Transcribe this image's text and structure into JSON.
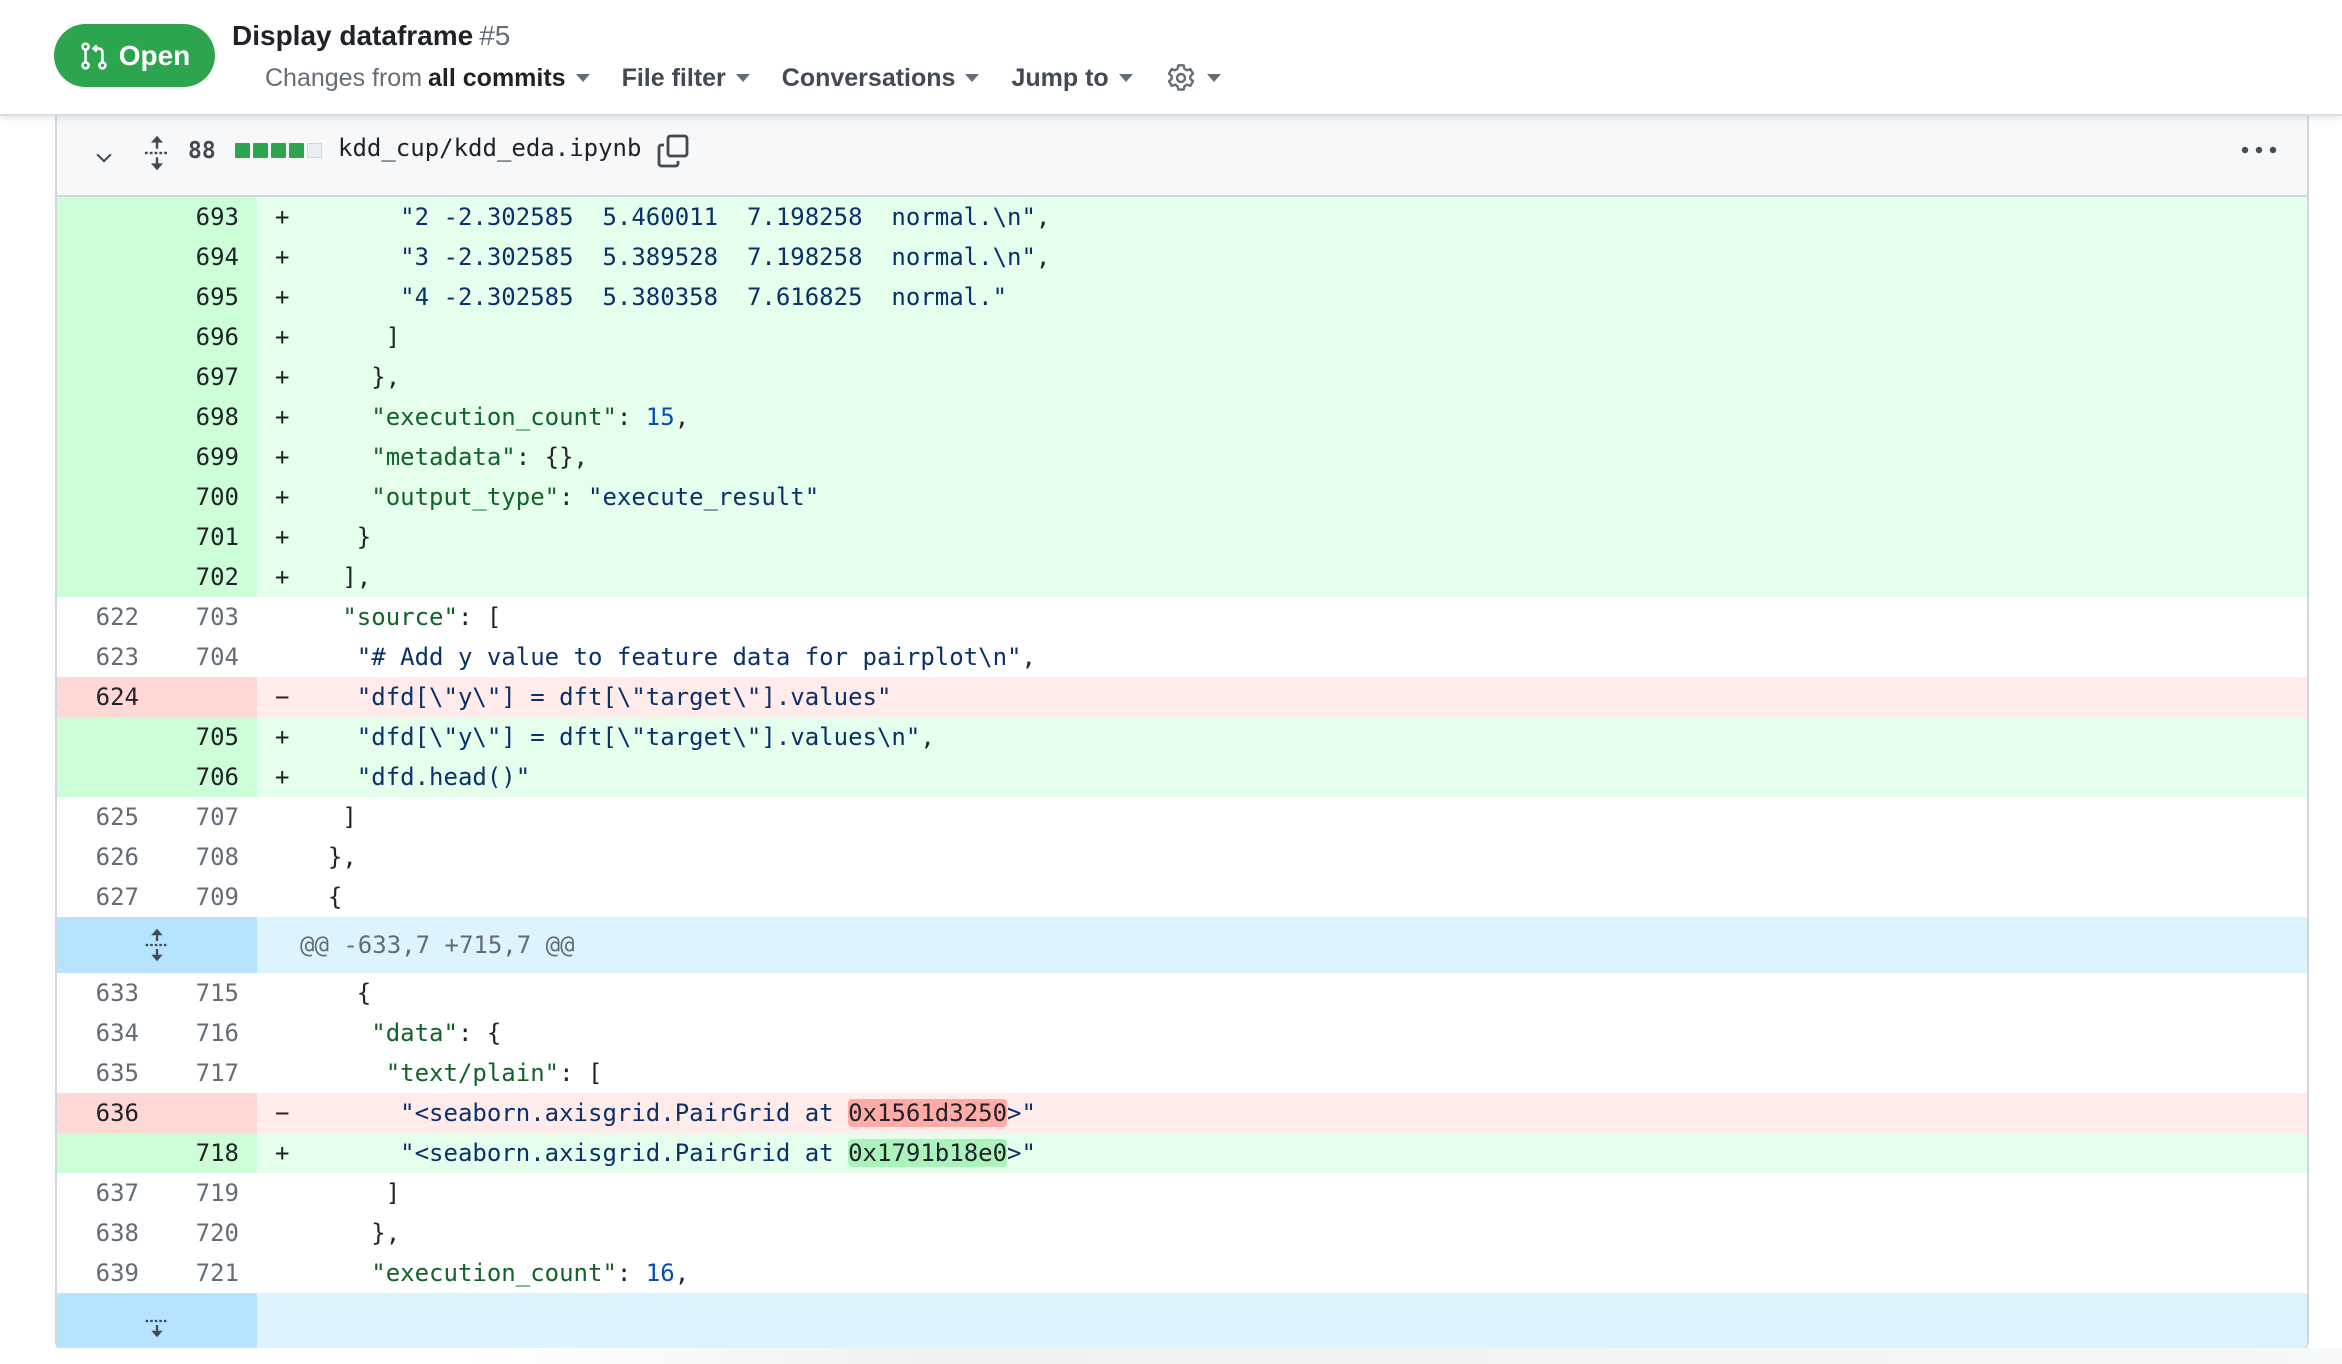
{
  "header": {
    "state_label": "Open",
    "state_color": "#2da44e",
    "title": "Display dataframe",
    "number": "#5",
    "toolbar": {
      "changes_prefix": "Changes from",
      "changes_value": "all commits",
      "file_filter": "File filter",
      "conversations": "Conversations",
      "jump_to": "Jump to",
      "settings_icon": "gear-icon"
    }
  },
  "file": {
    "changed_lines": "88",
    "diffstat": [
      "add",
      "add",
      "add",
      "add",
      "neutral"
    ],
    "path": "kdd_cup/kdd_eda.ipynb"
  },
  "rows": [
    {
      "type": "add",
      "old": "",
      "new": "693",
      "marker": "+",
      "indent": "       ",
      "tokens": [
        {
          "c": "s",
          "t": "\"2 -2.302585  5.460011  7.198258  normal.\\n\""
        },
        {
          "c": "",
          "t": ","
        }
      ]
    },
    {
      "type": "add",
      "old": "",
      "new": "694",
      "marker": "+",
      "indent": "       ",
      "tokens": [
        {
          "c": "s",
          "t": "\"3 -2.302585  5.389528  7.198258  normal.\\n\""
        },
        {
          "c": "",
          "t": ","
        }
      ]
    },
    {
      "type": "add",
      "old": "",
      "new": "695",
      "marker": "+",
      "indent": "       ",
      "tokens": [
        {
          "c": "s",
          "t": "\"4 -2.302585  5.380358  7.616825  normal.\""
        }
      ]
    },
    {
      "type": "add",
      "old": "",
      "new": "696",
      "marker": "+",
      "indent": "      ",
      "tokens": [
        {
          "c": "",
          "t": "]"
        }
      ]
    },
    {
      "type": "add",
      "old": "",
      "new": "697",
      "marker": "+",
      "indent": "     ",
      "tokens": [
        {
          "c": "",
          "t": "},"
        }
      ]
    },
    {
      "type": "add",
      "old": "",
      "new": "698",
      "marker": "+",
      "indent": "     ",
      "tokens": [
        {
          "c": "k",
          "t": "\"execution_count\""
        },
        {
          "c": "",
          "t": ": "
        },
        {
          "c": "n",
          "t": "15"
        },
        {
          "c": "",
          "t": ","
        }
      ]
    },
    {
      "type": "add",
      "old": "",
      "new": "699",
      "marker": "+",
      "indent": "     ",
      "tokens": [
        {
          "c": "k",
          "t": "\"metadata\""
        },
        {
          "c": "",
          "t": ": {},"
        }
      ]
    },
    {
      "type": "add",
      "old": "",
      "new": "700",
      "marker": "+",
      "indent": "     ",
      "tokens": [
        {
          "c": "k",
          "t": "\"output_type\""
        },
        {
          "c": "",
          "t": ": "
        },
        {
          "c": "s",
          "t": "\"execute_result\""
        }
      ]
    },
    {
      "type": "add",
      "old": "",
      "new": "701",
      "marker": "+",
      "indent": "    ",
      "tokens": [
        {
          "c": "",
          "t": "}"
        }
      ]
    },
    {
      "type": "add",
      "old": "",
      "new": "702",
      "marker": "+",
      "indent": "   ",
      "tokens": [
        {
          "c": "",
          "t": "],"
        }
      ]
    },
    {
      "type": "ctx",
      "old": "622",
      "new": "703",
      "marker": "",
      "indent": "   ",
      "tokens": [
        {
          "c": "k",
          "t": "\"source\""
        },
        {
          "c": "",
          "t": ": ["
        }
      ]
    },
    {
      "type": "ctx",
      "old": "623",
      "new": "704",
      "marker": "",
      "indent": "    ",
      "tokens": [
        {
          "c": "s",
          "t": "\"# Add y value to feature data for pairplot\\n\""
        },
        {
          "c": "",
          "t": ","
        }
      ]
    },
    {
      "type": "del",
      "old": "624",
      "new": "",
      "marker": "−",
      "indent": "    ",
      "tokens": [
        {
          "c": "s",
          "t": "\"dfd[\\\"y\\\"] = dft[\\\"target\\\"].values\""
        }
      ]
    },
    {
      "type": "add",
      "old": "",
      "new": "705",
      "marker": "+",
      "indent": "    ",
      "tokens": [
        {
          "c": "s",
          "t": "\"dfd[\\\"y\\\"] = dft[\\\"target\\\"].values\\n\""
        },
        {
          "c": "",
          "t": ","
        }
      ]
    },
    {
      "type": "add",
      "old": "",
      "new": "706",
      "marker": "+",
      "indent": "    ",
      "tokens": [
        {
          "c": "s",
          "t": "\"dfd.head()\""
        }
      ]
    },
    {
      "type": "ctx",
      "old": "625",
      "new": "707",
      "marker": "",
      "indent": "   ",
      "tokens": [
        {
          "c": "",
          "t": "]"
        }
      ]
    },
    {
      "type": "ctx",
      "old": "626",
      "new": "708",
      "marker": "",
      "indent": "  ",
      "tokens": [
        {
          "c": "",
          "t": "},"
        }
      ]
    },
    {
      "type": "ctx",
      "old": "627",
      "new": "709",
      "marker": "",
      "indent": "  ",
      "tokens": [
        {
          "c": "",
          "t": "{"
        }
      ]
    },
    {
      "type": "hunk",
      "text": "@@ -633,7 +715,7 @@"
    },
    {
      "type": "ctx",
      "old": "633",
      "new": "715",
      "marker": "",
      "indent": "    ",
      "tokens": [
        {
          "c": "",
          "t": "{"
        }
      ]
    },
    {
      "type": "ctx",
      "old": "634",
      "new": "716",
      "marker": "",
      "indent": "     ",
      "tokens": [
        {
          "c": "k",
          "t": "\"data\""
        },
        {
          "c": "",
          "t": ": {"
        }
      ]
    },
    {
      "type": "ctx",
      "old": "635",
      "new": "717",
      "marker": "",
      "indent": "      ",
      "tokens": [
        {
          "c": "k",
          "t": "\"text/plain\""
        },
        {
          "c": "",
          "t": ": ["
        }
      ]
    },
    {
      "type": "del",
      "old": "636",
      "new": "",
      "marker": "−",
      "indent": "       ",
      "tokens": [
        {
          "c": "s",
          "t": "\"<seaborn.axisgrid.PairGrid at "
        },
        {
          "c": "hl-del",
          "t": "0x1561d3250"
        },
        {
          "c": "s",
          "t": ">\""
        }
      ]
    },
    {
      "type": "add",
      "old": "",
      "new": "718",
      "marker": "+",
      "indent": "       ",
      "tokens": [
        {
          "c": "s",
          "t": "\"<seaborn.axisgrid.PairGrid at "
        },
        {
          "c": "hl-add",
          "t": "0x1791b18e0"
        },
        {
          "c": "s",
          "t": ">\""
        }
      ]
    },
    {
      "type": "ctx",
      "old": "637",
      "new": "719",
      "marker": "",
      "indent": "      ",
      "tokens": [
        {
          "c": "",
          "t": "]"
        }
      ]
    },
    {
      "type": "ctx",
      "old": "638",
      "new": "720",
      "marker": "",
      "indent": "     ",
      "tokens": [
        {
          "c": "",
          "t": "},"
        }
      ]
    },
    {
      "type": "ctx",
      "old": "639",
      "new": "721",
      "marker": "",
      "indent": "     ",
      "tokens": [
        {
          "c": "k",
          "t": "\"execution_count\""
        },
        {
          "c": "",
          "t": ": "
        },
        {
          "c": "n",
          "t": "16"
        },
        {
          "c": "",
          "t": ","
        }
      ]
    },
    {
      "type": "tail"
    }
  ]
}
